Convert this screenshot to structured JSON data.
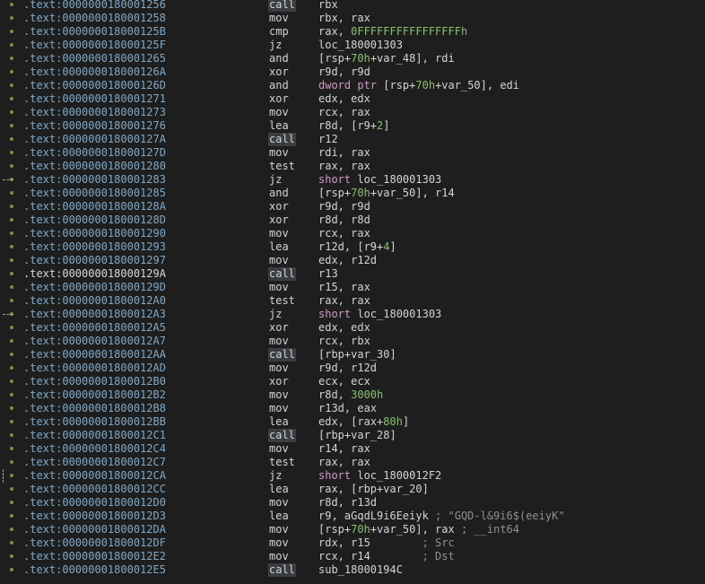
{
  "colors": {
    "background": "#1e1e1e",
    "address": "#7fa8c8",
    "text": "#d4d4d4",
    "number": "#88c070",
    "keyword": "#d09ac8",
    "comment": "#909090",
    "dot": "#8a8a3a"
  },
  "rows": [
    {
      "addr": ".text:0000000180001256",
      "mnem": "call",
      "ops": [
        [
          "t",
          "rbx"
        ]
      ]
    },
    {
      "addr": ".text:0000000180001258",
      "mnem": "mov",
      "ops": [
        [
          "t",
          "rbx, rax"
        ]
      ]
    },
    {
      "addr": ".text:000000018000125B",
      "mnem": "cmp",
      "ops": [
        [
          "t",
          "rax, "
        ],
        [
          "n",
          "0FFFFFFFFFFFFFFFFh"
        ]
      ]
    },
    {
      "addr": ".text:000000018000125F",
      "mnem": "jz",
      "ops": [
        [
          "t",
          "loc_180001303"
        ]
      ]
    },
    {
      "addr": ".text:0000000180001265",
      "mnem": "and",
      "ops": [
        [
          "t",
          "[rsp+"
        ],
        [
          "n",
          "70h"
        ],
        [
          "t",
          "+var_48], rdi"
        ]
      ]
    },
    {
      "addr": ".text:000000018000126A",
      "mnem": "xor",
      "ops": [
        [
          "t",
          "r9d, r9d"
        ]
      ]
    },
    {
      "addr": ".text:000000018000126D",
      "mnem": "and",
      "ops": [
        [
          "k",
          "dword ptr"
        ],
        [
          "t",
          " [rsp+"
        ],
        [
          "n",
          "70h"
        ],
        [
          "t",
          "+var_50], edi"
        ]
      ]
    },
    {
      "addr": ".text:0000000180001271",
      "mnem": "xor",
      "ops": [
        [
          "t",
          "edx, edx"
        ]
      ]
    },
    {
      "addr": ".text:0000000180001273",
      "mnem": "mov",
      "ops": [
        [
          "t",
          "rcx, rax"
        ]
      ]
    },
    {
      "addr": ".text:0000000180001276",
      "mnem": "lea",
      "ops": [
        [
          "t",
          "r8d, [r9+"
        ],
        [
          "n",
          "2"
        ],
        [
          "t",
          "]"
        ]
      ]
    },
    {
      "addr": ".text:000000018000127A",
      "mnem": "call",
      "ops": [
        [
          "t",
          "r12"
        ]
      ]
    },
    {
      "addr": ".text:000000018000127D",
      "mnem": "mov",
      "ops": [
        [
          "t",
          "rdi, rax"
        ]
      ]
    },
    {
      "addr": ".text:0000000180001280",
      "mnem": "test",
      "ops": [
        [
          "t",
          "rax, rax"
        ]
      ]
    },
    {
      "addr": ".text:0000000180001283",
      "mnem": "jz",
      "ops": [
        [
          "k",
          "short"
        ],
        [
          "t",
          " loc_180001303"
        ]
      ]
    },
    {
      "addr": ".text:0000000180001285",
      "mnem": "and",
      "ops": [
        [
          "t",
          "[rsp+"
        ],
        [
          "n",
          "70h"
        ],
        [
          "t",
          "+var_50], r14"
        ]
      ]
    },
    {
      "addr": ".text:000000018000128A",
      "mnem": "xor",
      "ops": [
        [
          "t",
          "r9d, r9d"
        ]
      ]
    },
    {
      "addr": ".text:000000018000128D",
      "mnem": "xor",
      "ops": [
        [
          "t",
          "r8d, r8d"
        ]
      ]
    },
    {
      "addr": ".text:0000000180001290",
      "mnem": "mov",
      "ops": [
        [
          "t",
          "rcx, rax"
        ]
      ]
    },
    {
      "addr": ".text:0000000180001293",
      "mnem": "lea",
      "ops": [
        [
          "t",
          "r12d, [r9+"
        ],
        [
          "n",
          "4"
        ],
        [
          "t",
          "]"
        ]
      ]
    },
    {
      "addr": ".text:0000000180001297",
      "mnem": "mov",
      "ops": [
        [
          "t",
          "edx, r12d"
        ]
      ]
    },
    {
      "addr": ".text:000000018000129A",
      "mnem": "call",
      "ops": [
        [
          "t",
          "r13"
        ]
      ]
    },
    {
      "addr": ".text:000000018000129D",
      "mnem": "mov",
      "ops": [
        [
          "t",
          "r15, rax"
        ]
      ]
    },
    {
      "addr": ".text:00000001800012A0",
      "mnem": "test",
      "ops": [
        [
          "t",
          "rax, rax"
        ]
      ]
    },
    {
      "addr": ".text:00000001800012A3",
      "mnem": "jz",
      "ops": [
        [
          "k",
          "short"
        ],
        [
          "t",
          " loc_180001303"
        ]
      ]
    },
    {
      "addr": ".text:00000001800012A5",
      "mnem": "xor",
      "ops": [
        [
          "t",
          "edx, edx"
        ]
      ]
    },
    {
      "addr": ".text:00000001800012A7",
      "mnem": "mov",
      "ops": [
        [
          "t",
          "rcx, rbx"
        ]
      ]
    },
    {
      "addr": ".text:00000001800012AA",
      "mnem": "call",
      "ops": [
        [
          "t",
          "[rbp+var_30]"
        ]
      ]
    },
    {
      "addr": ".text:00000001800012AD",
      "mnem": "mov",
      "ops": [
        [
          "t",
          "r9d, r12d"
        ]
      ]
    },
    {
      "addr": ".text:00000001800012B0",
      "mnem": "xor",
      "ops": [
        [
          "t",
          "ecx, ecx"
        ]
      ]
    },
    {
      "addr": ".text:00000001800012B2",
      "mnem": "mov",
      "ops": [
        [
          "t",
          "r8d, "
        ],
        [
          "n",
          "3000h"
        ]
      ]
    },
    {
      "addr": ".text:00000001800012B8",
      "mnem": "mov",
      "ops": [
        [
          "t",
          "r13d, eax"
        ]
      ]
    },
    {
      "addr": ".text:00000001800012BB",
      "mnem": "lea",
      "ops": [
        [
          "t",
          "edx, [rax+"
        ],
        [
          "n",
          "80h"
        ],
        [
          "t",
          "]"
        ]
      ]
    },
    {
      "addr": ".text:00000001800012C1",
      "mnem": "call",
      "ops": [
        [
          "t",
          "[rbp+var_28]"
        ]
      ]
    },
    {
      "addr": ".text:00000001800012C4",
      "mnem": "mov",
      "ops": [
        [
          "t",
          "r14, rax"
        ]
      ]
    },
    {
      "addr": ".text:00000001800012C7",
      "mnem": "test",
      "ops": [
        [
          "t",
          "rax, rax"
        ]
      ]
    },
    {
      "addr": ".text:00000001800012CA",
      "mnem": "jz",
      "ops": [
        [
          "k",
          "short"
        ],
        [
          "t",
          " loc_1800012F2"
        ]
      ]
    },
    {
      "addr": ".text:00000001800012CC",
      "mnem": "lea",
      "ops": [
        [
          "t",
          "rax, [rbp+var_20]"
        ]
      ]
    },
    {
      "addr": ".text:00000001800012D0",
      "mnem": "mov",
      "ops": [
        [
          "t",
          "r8d, r13d"
        ]
      ]
    },
    {
      "addr": ".text:00000001800012D3",
      "mnem": "lea",
      "ops": [
        [
          "t",
          "r9, aGqdL9i6Eeiyk "
        ],
        [
          "c",
          "; \"GQD-l&9i6$(eeiyK\""
        ]
      ]
    },
    {
      "addr": ".text:00000001800012DA",
      "mnem": "mov",
      "ops": [
        [
          "t",
          "[rsp+"
        ],
        [
          "n",
          "70h"
        ],
        [
          "t",
          "+var_50], rax "
        ],
        [
          "c",
          "; __int64"
        ]
      ]
    },
    {
      "addr": ".text:00000001800012DF",
      "mnem": "mov",
      "ops": [
        [
          "t",
          "rdx, r15        "
        ],
        [
          "c",
          "; Src"
        ]
      ]
    },
    {
      "addr": ".text:00000001800012E2",
      "mnem": "mov",
      "ops": [
        [
          "t",
          "rcx, r14        "
        ],
        [
          "c",
          "; Dst"
        ]
      ]
    },
    {
      "addr": ".text:00000001800012E5",
      "mnem": "call",
      "ops": [
        [
          "t",
          "sub_18000194C"
        ]
      ]
    }
  ]
}
